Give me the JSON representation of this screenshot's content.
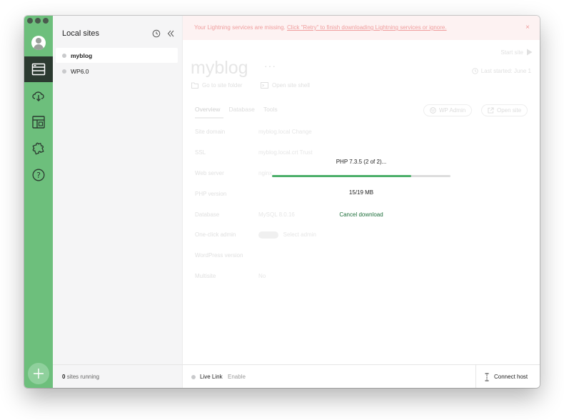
{
  "sidebar": {
    "title": "Local sites",
    "sites": [
      {
        "name": "myblog",
        "active": true
      },
      {
        "name": "WP6.0",
        "active": false
      }
    ],
    "footer_count": "0",
    "footer_suffix": "sites running"
  },
  "notice": {
    "text": "Your Lightning services are missing.",
    "link": "Click \"Retry\" to finish downloading Lightning services or ignore."
  },
  "site": {
    "title": "myblog",
    "more": "···",
    "start_label": "Start site",
    "last_started": "Last started: June 1",
    "go_to_folder": "Go to site folder",
    "open_shell": "Open site shell",
    "tabs": [
      "Overview",
      "Database",
      "Tools"
    ],
    "wp_admin": "WP Admin",
    "open_site": "Open site",
    "rows": [
      {
        "label": "Site domain",
        "value": "myblog.local  Change"
      },
      {
        "label": "SSL",
        "value": "myblog.local.crt    Trust"
      },
      {
        "label": "Web server",
        "value": "nginx"
      },
      {
        "label": "PHP version",
        "value": ""
      },
      {
        "label": "Database",
        "value": "MySQL 8.0.16"
      },
      {
        "label": "One-click admin",
        "value": "Select admin"
      },
      {
        "label": "WordPress version",
        "value": ""
      },
      {
        "label": "Multisite",
        "value": "No"
      }
    ]
  },
  "download": {
    "title": "PHP 7.3.5 (2 of 2)...",
    "progress": 0.78,
    "size": "15/19 MB",
    "cancel": "Cancel download"
  },
  "footer": {
    "live_link": "Live Link",
    "enable": "Enable",
    "connect_host": "Connect host"
  },
  "colors": {
    "rail": "#6dbf7c",
    "rail_active": "#2b3a30",
    "progress": "#4caf6a",
    "cancel_link": "#1d6e3a"
  }
}
